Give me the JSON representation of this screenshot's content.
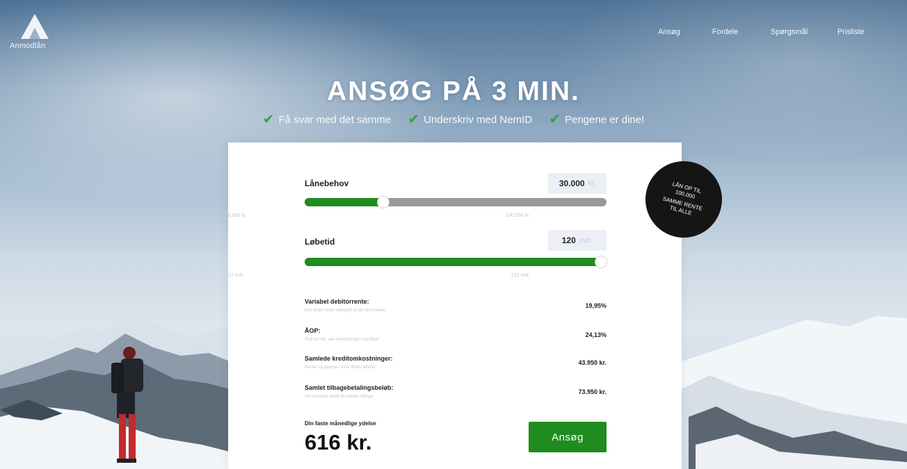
{
  "brand": {
    "name": "Anmodlån"
  },
  "nav": {
    "items": [
      "Ansøg",
      "Fordele",
      "Spørgsmål",
      "Prisliste"
    ]
  },
  "hero": {
    "title": "ANSØG PÅ 3 MIN.",
    "usps": [
      "Få svar med det samme",
      "Underskriv med NemID",
      "Pengene er dine!"
    ]
  },
  "badge": {
    "line1": "LÅN OP TIL",
    "line2": "100.000",
    "line3": "SAMME RENTE",
    "line4": "TIL ALLE"
  },
  "calculator": {
    "amount": {
      "label": "Lånebehov",
      "value": "30.000",
      "unit": "kr.",
      "min": "5.000 kr.",
      "max": "100.000 kr.",
      "fraction": 0.26
    },
    "term": {
      "label": "Løbetid",
      "value": "120",
      "unit": "mdr.",
      "min": "12 mdr.",
      "max": "120 mdr.",
      "fraction": 1.0
    },
    "details": [
      {
        "label": "Variabel debitorrente:",
        "sub": "Den årlige rente udregnet af det lånte beløb",
        "value": "19,95%"
      },
      {
        "label": "ÅOP:",
        "sub": "ÅOP er inkl. alle omkostninger ved lånet",
        "value": "24,13%"
      },
      {
        "label": "Samlede kreditomkostninger:",
        "sub": "Renter og gebyrer i hele lånets løbetid",
        "value": "43.950 kr."
      },
      {
        "label": "Samlet tilbagebetalingsbeløb:",
        "sub": "Det samlede beløb du betaler tilbage",
        "value": "73.950 kr."
      }
    ],
    "monthly": {
      "label": "Din faste månedlige ydelse",
      "value": "616 kr."
    },
    "apply_label": "Ansøg"
  },
  "colors": {
    "accent": "#1e8c1e",
    "track": "#999999",
    "badge": "#151515"
  }
}
